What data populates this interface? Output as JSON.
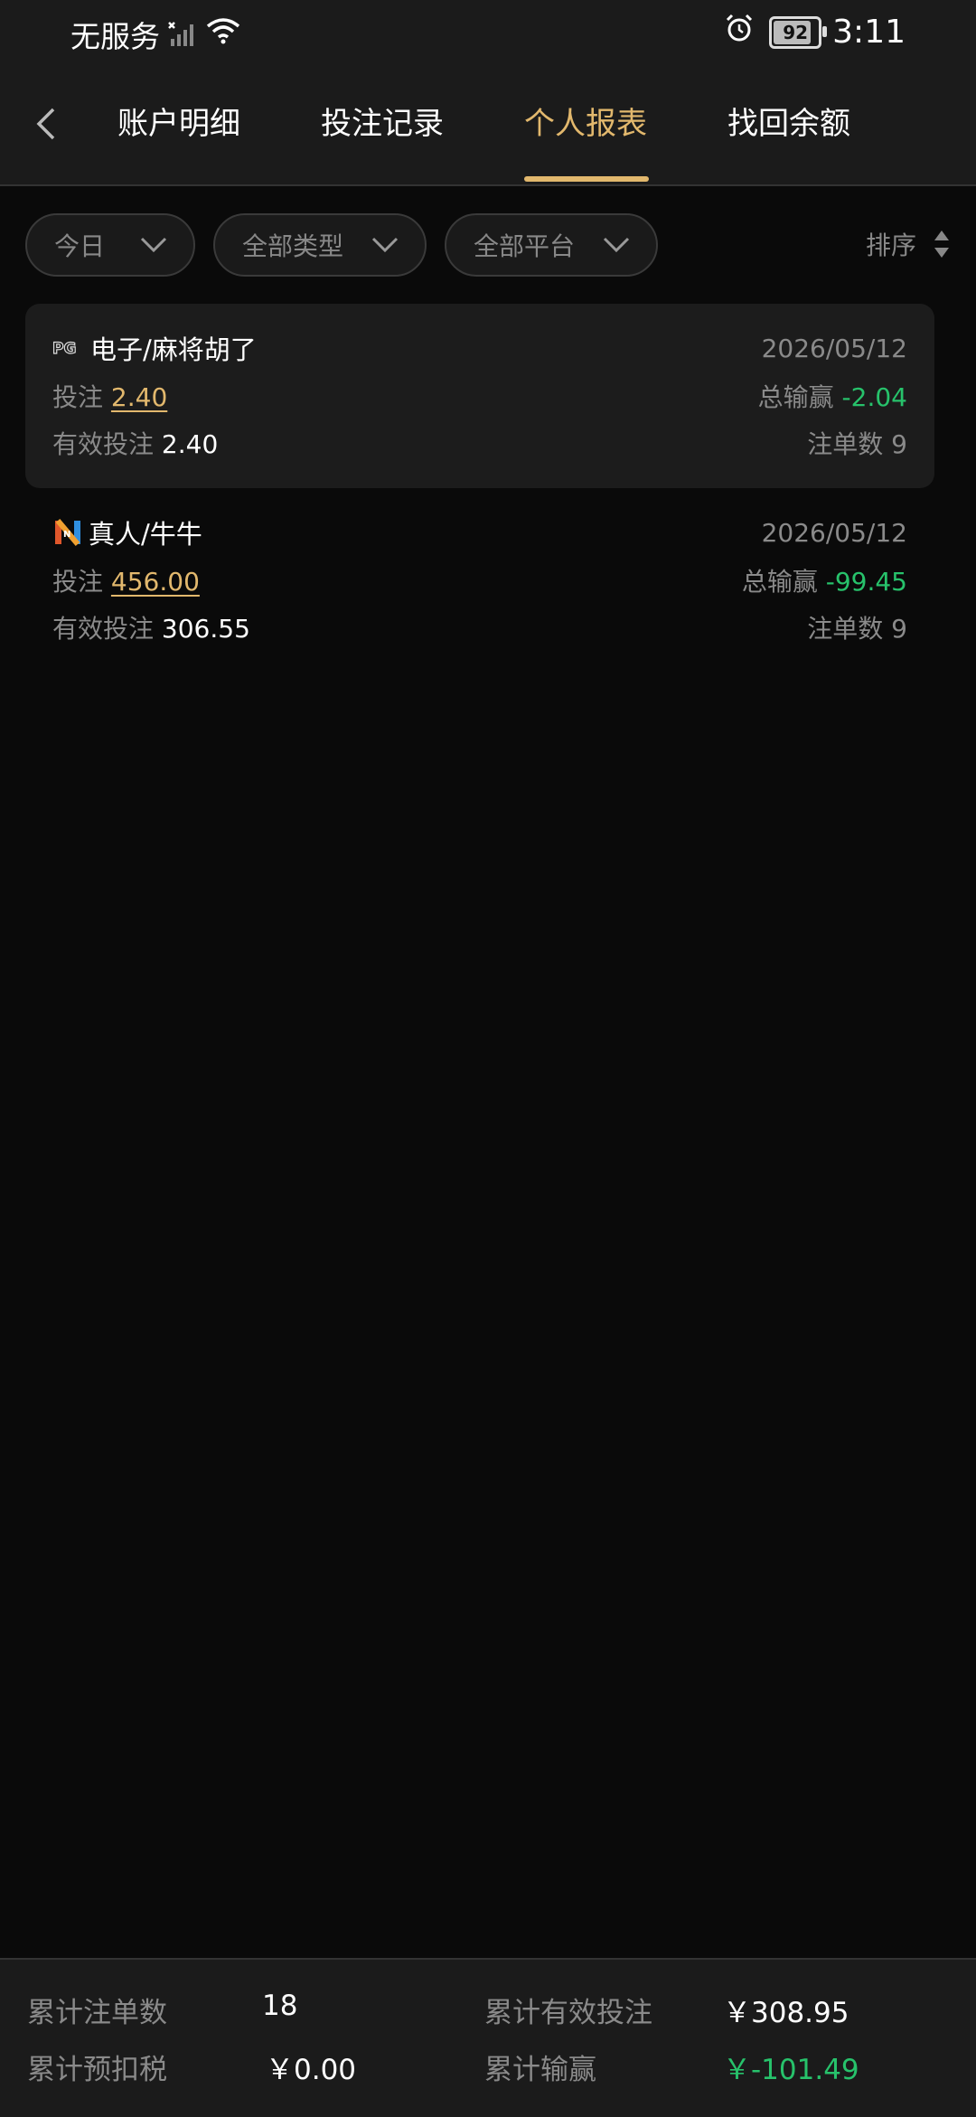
{
  "status_bar": {
    "carrier": "无服务",
    "time": "3:11",
    "battery": "92",
    "battery_level": 0.92
  },
  "nav": {
    "tabs": [
      {
        "label": "账户明细",
        "active": false
      },
      {
        "label": "投注记录",
        "active": false
      },
      {
        "label": "个人报表",
        "active": true
      },
      {
        "label": "找回余额",
        "active": false
      }
    ]
  },
  "filters": {
    "date": "今日",
    "type": "全部类型",
    "platform": "全部平台",
    "sort": "排序"
  },
  "records": [
    {
      "platform_badge": "PG",
      "title": "电子/麻将胡了",
      "date": "2026/05/12",
      "bet_label": "投注",
      "bet": "2.40",
      "winloss_label": "总输赢",
      "winloss": "-2.04",
      "valid_bet_label": "有效投注",
      "valid_bet": "2.40",
      "order_count_label": "注单数",
      "order_count": "9"
    },
    {
      "platform_badge": "N",
      "title": "真人/牛牛",
      "date": "2026/05/12",
      "bet_label": "投注",
      "bet": "456.00",
      "winloss_label": "总输赢",
      "winloss": "-99.45",
      "valid_bet_label": "有效投注",
      "valid_bet": "306.55",
      "order_count_label": "注单数",
      "order_count": "9"
    }
  ],
  "summary": {
    "total_orders_label": "累计注单数",
    "total_orders": "18",
    "total_valid_bet_label": "累计有效投注",
    "total_valid_bet": "￥308.95",
    "total_tax_label": "累计预扣税",
    "total_tax": "￥0.00",
    "total_winloss_label": "累计输赢",
    "total_winloss": "￥-101.49"
  },
  "colors": {
    "accent": "#e2b86d",
    "loss": "#27c26b",
    "background": "#0a0a0a"
  }
}
